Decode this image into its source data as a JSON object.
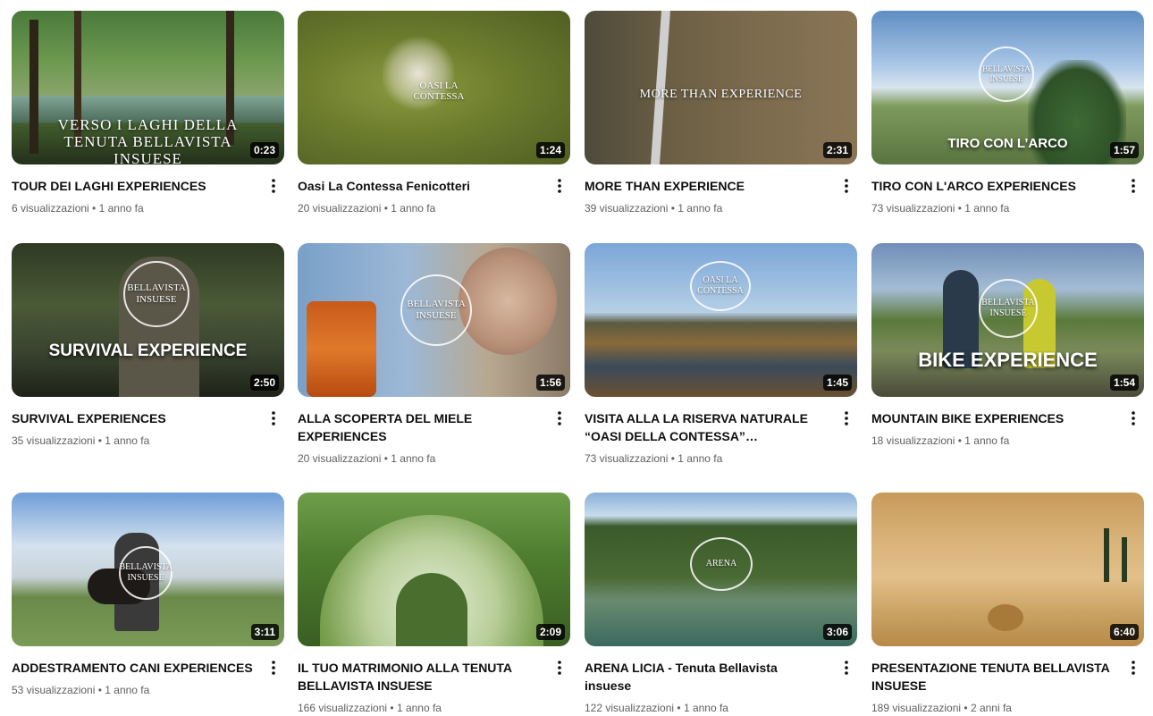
{
  "separator": " • ",
  "videos": [
    {
      "title": "TOUR DEI LAGHI EXPERIENCES",
      "views": "6 visualizzazioni",
      "age": "1 anno fa",
      "duration": "0:23",
      "overlay": "VERSO I LAGHI DELLA TENUTA BELLAVISTA INSUESE"
    },
    {
      "title": "Oasi La Contessa Fenicotteri",
      "views": "20 visualizzazioni",
      "age": "1 anno fa",
      "duration": "1:24",
      "overlay": "OASI LA CONTESSA"
    },
    {
      "title": "MORE THAN EXPERIENCE",
      "views": "39 visualizzazioni",
      "age": "1 anno fa",
      "duration": "2:31",
      "overlay": "MORE THAN EXPERIENCE"
    },
    {
      "title": "TIRO CON L'ARCO EXPERIENCES",
      "views": "73 visualizzazioni",
      "age": "1 anno fa",
      "duration": "1:57",
      "overlay": "TIRO CON L’ARCO"
    },
    {
      "title": "SURVIVAL EXPERIENCES",
      "views": "35 visualizzazioni",
      "age": "1 anno fa",
      "duration": "2:50",
      "overlay": "SURVIVAL EXPERIENCE"
    },
    {
      "title": "ALLA SCOPERTA DEL MIELE EXPERIENCES",
      "views": "20 visualizzazioni",
      "age": "1 anno fa",
      "duration": "1:56",
      "overlay": ""
    },
    {
      "title": "VISITA ALLA LA RISERVA NATURALE “OASI DELLA CONTESSA” EXPERIENCES",
      "views": "73 visualizzazioni",
      "age": "1 anno fa",
      "duration": "1:45",
      "overlay": "OASI LA CONTESSA"
    },
    {
      "title": "MOUNTAIN BIKE EXPERIENCES",
      "views": "18 visualizzazioni",
      "age": "1 anno fa",
      "duration": "1:54",
      "overlay": "BIKE EXPERIENCE"
    },
    {
      "title": "ADDESTRAMENTO CANI EXPERIENCES",
      "views": "53 visualizzazioni",
      "age": "1 anno fa",
      "duration": "3:11",
      "overlay": ""
    },
    {
      "title": "IL TUO MATRIMONIO ALLA TENUTA BELLAVISTA INSUESE",
      "views": "166 visualizzazioni",
      "age": "1 anno fa",
      "duration": "2:09",
      "overlay": ""
    },
    {
      "title": "ARENA LICIA - Tenuta Bellavista insuese",
      "views": "122 visualizzazioni",
      "age": "1 anno fa",
      "duration": "3:06",
      "overlay": "ARENA"
    },
    {
      "title": "PRESENTAZIONE TENUTA BELLAVISTA INSUESE",
      "views": "189 visualizzazioni",
      "age": "2 anni fa",
      "duration": "6:40",
      "overlay": ""
    }
  ],
  "logo_text": "BELLAVISTA INSUESE",
  "icons": {
    "menu": "more-vert-icon"
  }
}
